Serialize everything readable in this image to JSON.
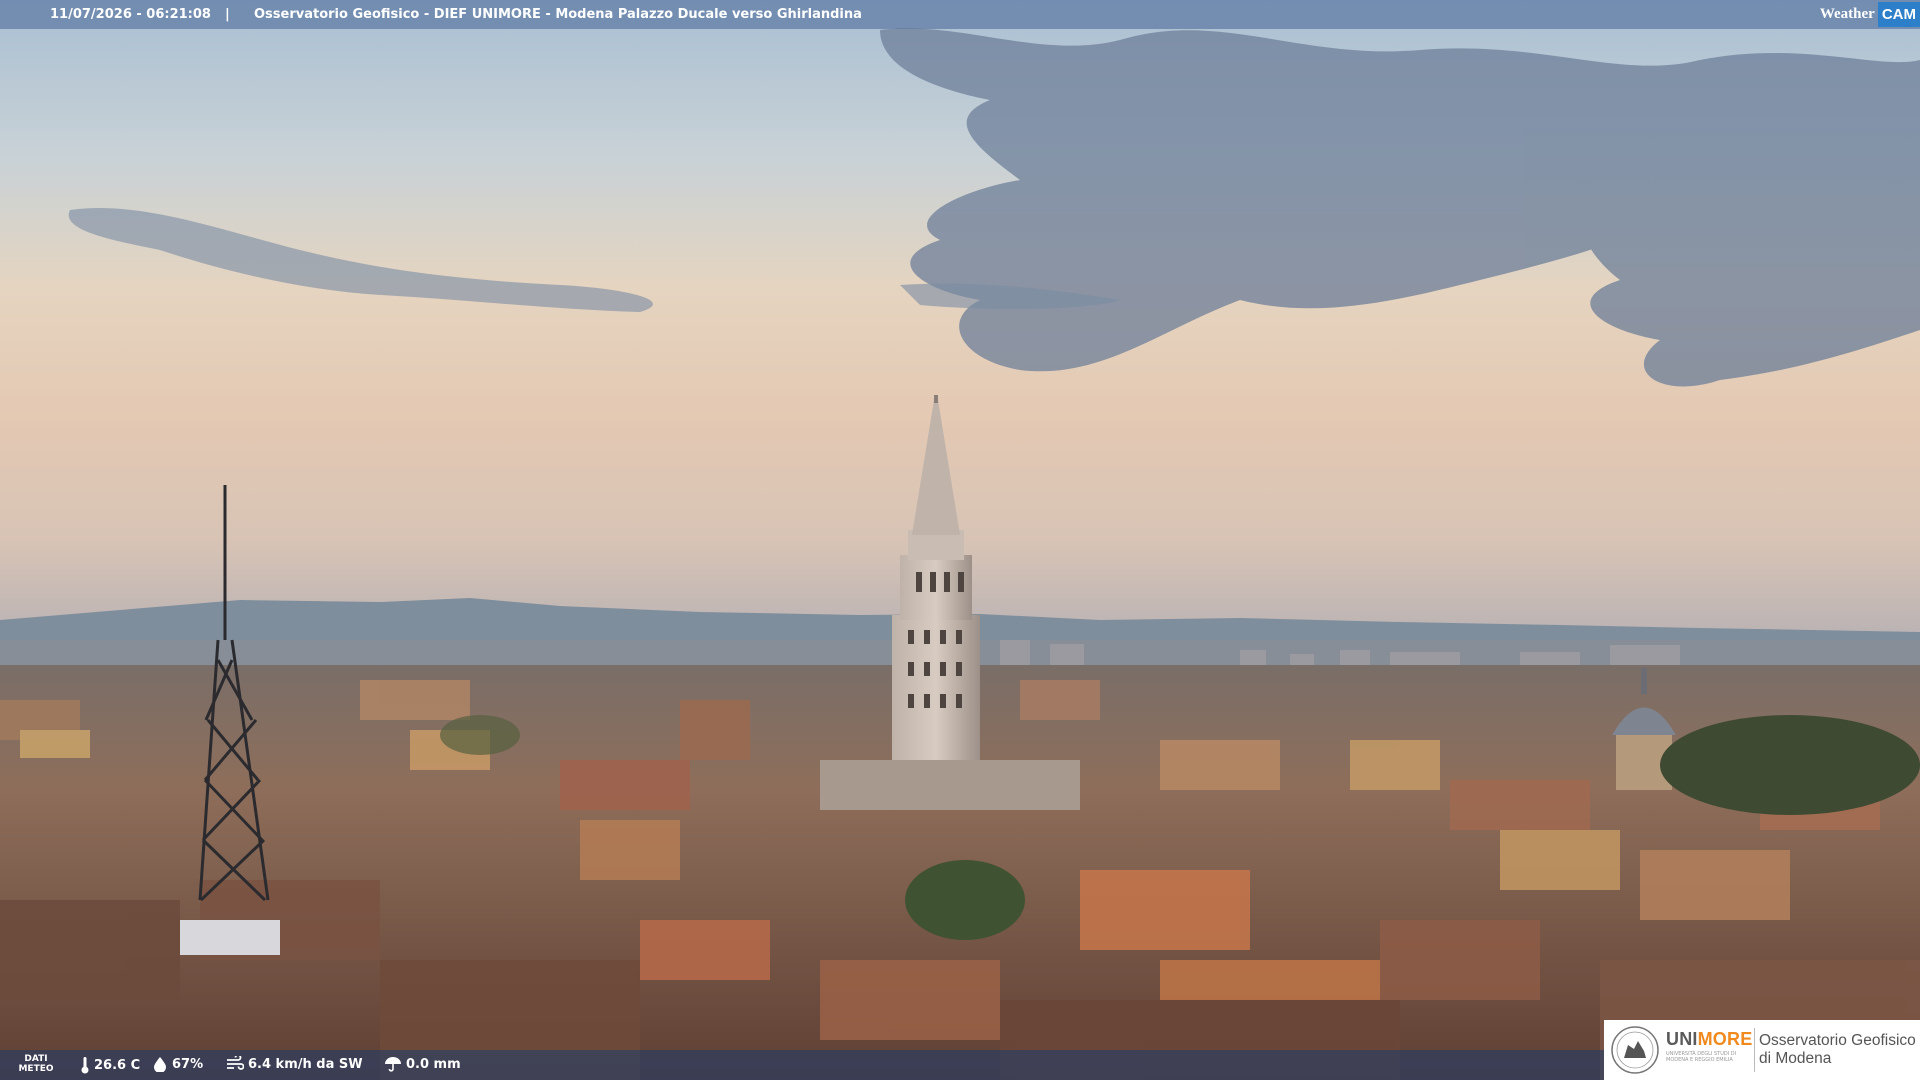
{
  "overlay": {
    "datetime": "11/07/2026 - 06:21:08",
    "separator": "|",
    "caption": "Osservatorio Geofisico - DIEF UNIMORE - Modena Palazzo Ducale verso Ghirlandina",
    "brand": {
      "weather": "Weather",
      "cam": "CAM"
    }
  },
  "weather": {
    "label_line1": "DATI",
    "label_line2": "METEO",
    "temperature": "26.6 C",
    "humidity": "67%",
    "wind": "6.4 km/h da SW",
    "rain": "0.0 mm"
  },
  "logo": {
    "uni_a": "UNI",
    "uni_b": "MORE",
    "uni_sub": "UNIVERSITÀ DEGLI STUDI DI MODENA E REGGIO EMILIA",
    "observatory_line1": "Osservatorio Geofisico",
    "observatory_line2": "di Modena"
  },
  "colors": {
    "sky_top": "#a8bfd4",
    "sky_mid": "#e6cdb3",
    "sky_horizon": "#dbc4b0",
    "mountains": "#7c8a99",
    "roofs": "#8a5a44",
    "brand_orange": "#f08a1f",
    "brand_blue": "#2c7fc8"
  }
}
